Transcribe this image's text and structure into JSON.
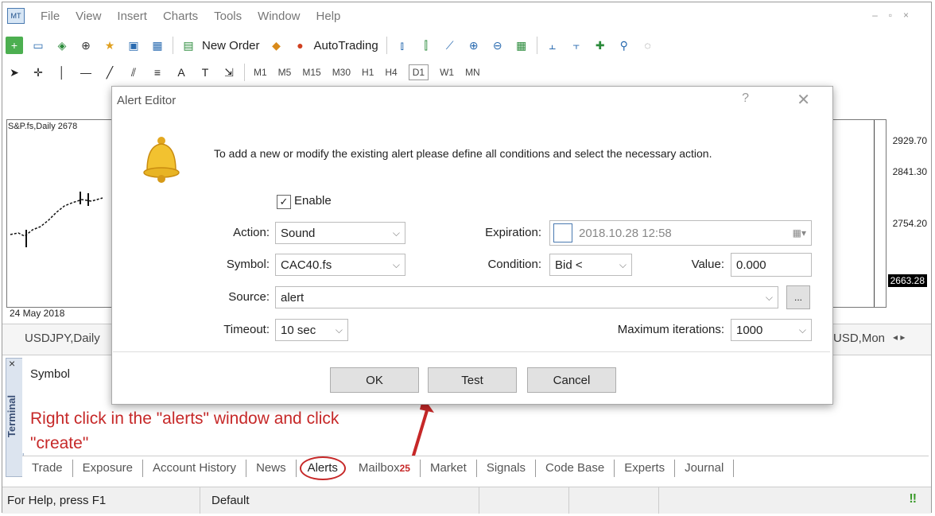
{
  "menu": {
    "items": [
      "File",
      "View",
      "Insert",
      "Charts",
      "Tools",
      "Window",
      "Help"
    ]
  },
  "toolbar": {
    "new_order": "New Order",
    "autotrading": "AutoTrading",
    "timeframes": [
      "M1",
      "M5",
      "M15",
      "M30",
      "H1",
      "H4",
      "D1",
      "W1",
      "MN"
    ]
  },
  "chart": {
    "title": "S&P.fs,Daily 2678",
    "prices": [
      "2929.70",
      "2841.30",
      "2754.20",
      "2663.28"
    ],
    "date": "24 May 2018"
  },
  "chart_tabs": [
    "USDJPY,Daily",
    "USD,Mon"
  ],
  "dialog": {
    "title": "Alert Editor",
    "help": "?",
    "close": "✕",
    "message": "To add a new or modify the existing alert please define all conditions and select the necessary action.",
    "enable_label": "Enable",
    "action_label": "Action:",
    "action_value": "Sound",
    "symbol_label": "Symbol:",
    "symbol_value": "CAC40.fs",
    "source_label": "Source:",
    "source_value": "alert",
    "timeout_label": "Timeout:",
    "timeout_value": "10 sec",
    "expiration_label": "Expiration:",
    "expiration_value": "2018.10.28 12:58",
    "condition_label": "Condition:",
    "condition_value": "Bid <",
    "value_label": "Value:",
    "value_value": "0.000",
    "max_iter_label": "Maximum iterations:",
    "max_iter_value": "1000",
    "browse_label": "...",
    "ok": "OK",
    "test": "Test",
    "cancel": "Cancel"
  },
  "terminal": {
    "label": "Terminal",
    "column_header": "Symbol",
    "close": "×",
    "annotation_line1": "Right click in the \"alerts\" window and click",
    "annotation_line2": "\"create\"",
    "tabs": [
      "Trade",
      "Exposure",
      "Account History",
      "News",
      "Alerts",
      "Mailbox",
      "Market",
      "Signals",
      "Code Base",
      "Experts",
      "Journal"
    ],
    "mailbox_badge": "25"
  },
  "status": {
    "help": "For Help, press F1",
    "profile": "Default"
  },
  "colors": {
    "accent": "#c62828",
    "bell": "#f2c230"
  }
}
